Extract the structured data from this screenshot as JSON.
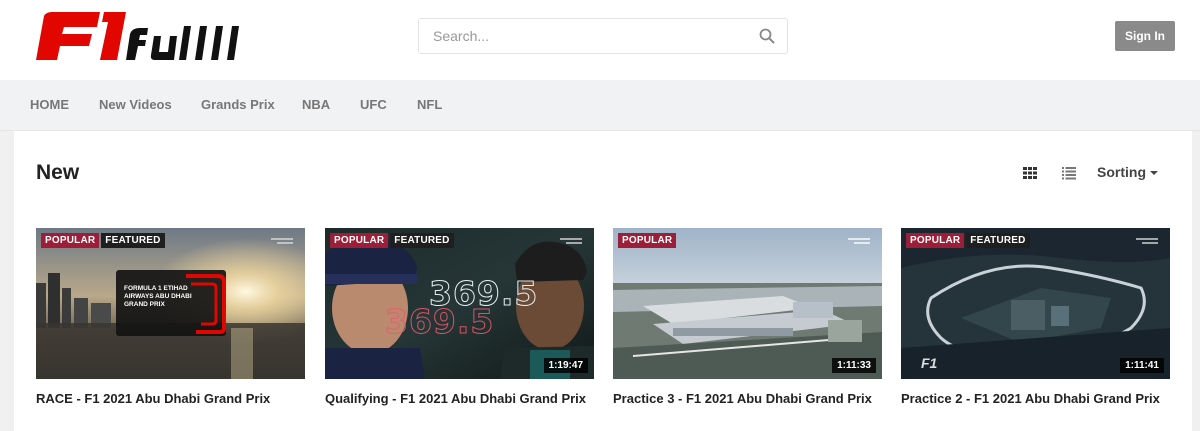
{
  "header": {
    "logo_alt": "F1full",
    "search_placeholder": "Search...",
    "sign_in_label": "Sign In"
  },
  "nav": {
    "items": [
      {
        "label": "HOME"
      },
      {
        "label": "New Videos"
      },
      {
        "label": "Grands Prix"
      },
      {
        "label": "NBA"
      },
      {
        "label": "UFC"
      },
      {
        "label": "NFL"
      }
    ]
  },
  "section": {
    "title": "New",
    "sorting_label": "Sorting"
  },
  "videos": [
    {
      "title": "RACE - F1 2021 Abu Dhabi Grand Prix",
      "badges": [
        "POPULAR",
        "FEATURED"
      ],
      "duration": "",
      "overlay_text": "FORMULA 1 ETIHAD AIRWAYS ABU DHABI GRAND PRIX"
    },
    {
      "title": "Qualifying - F1 2021 Abu Dhabi Grand Prix",
      "badges": [
        "POPULAR",
        "FEATURED"
      ],
      "duration": "1:19:47"
    },
    {
      "title": "Practice 3 - F1 2021 Abu Dhabi Grand Prix",
      "badges": [
        "POPULAR"
      ],
      "duration": "1:11:33"
    },
    {
      "title": "Practice 2 - F1 2021 Abu Dhabi Grand Prix",
      "badges": [
        "POPULAR",
        "FEATURED"
      ],
      "duration": "1:11:41"
    }
  ],
  "colors": {
    "popular_badge": "#9c1e38",
    "featured_badge": "#1f1f1f",
    "logo_red": "#e10600",
    "sign_in_bg": "#8a8a8a"
  },
  "icons": {
    "search": "search-icon",
    "grid_view": "grid-view-icon",
    "list_view": "list-view-icon",
    "sort": "chevron-down-icon"
  }
}
